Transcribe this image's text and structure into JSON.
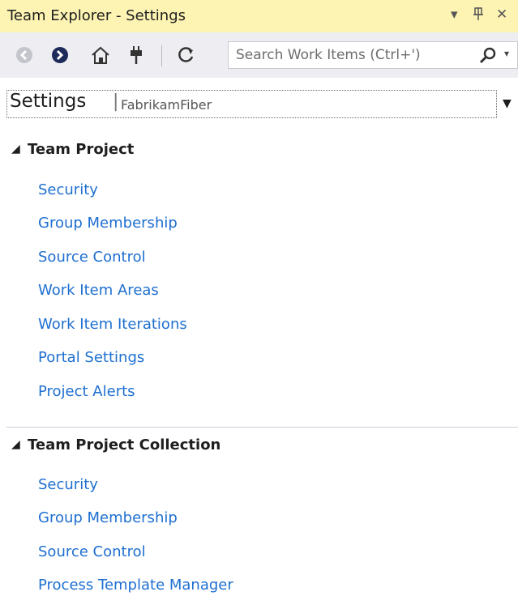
{
  "window": {
    "title": "Team Explorer - Settings",
    "dropdown_glyph": "▾",
    "pin_glyph": "Ᵽ",
    "close_glyph": "✕"
  },
  "toolbar": {
    "buttons": [
      "back-icon",
      "forward-icon",
      "home-icon",
      "connect-icon",
      "refresh-icon"
    ],
    "search_placeholder": "Search Work Items (Ctrl+')",
    "accent_color": "#1e6fd0"
  },
  "context": {
    "page": "Settings",
    "separator": "|",
    "project": "FabrikamFiber"
  },
  "sections": [
    {
      "title": "Team Project",
      "links": [
        "Security",
        "Group Membership",
        "Source Control",
        "Work Item Areas",
        "Work Item Iterations",
        "Portal Settings",
        "Project Alerts"
      ]
    },
    {
      "title": "Team Project Collection",
      "links": [
        "Security",
        "Group Membership",
        "Source Control",
        "Process Template Manager"
      ]
    }
  ]
}
